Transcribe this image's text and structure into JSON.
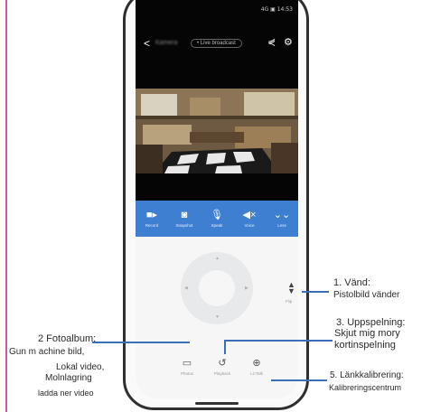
{
  "app": {
    "status_bar": "4G ▣ 14:53",
    "title": "Kamera",
    "live_pill": "• Live broadcast"
  },
  "toolbar": {
    "record": "Record",
    "snapshot": "Snapshot",
    "speak": "Speak",
    "voice": "Voice",
    "less": "Less"
  },
  "controls": {
    "flip_label": "Flip",
    "photos": "Photos",
    "playback": "Playback",
    "cctalk": "LCTalk"
  },
  "annotations": {
    "flip_title": "1. Vänd:",
    "flip_text": "Pistolbild vänder",
    "album_title": "2 Fotoalbum:",
    "album_l1": "Gun m achine bild,",
    "album_l2": "Lokal video,",
    "album_l3": "Molnlagring",
    "album_l4": "ladda ner video",
    "playback_title": "3. Uppspelning:",
    "playback_l1": "Skjut mig mory",
    "playback_l2": "kortinspelning",
    "calib_title": "5. Länkkalibrering:",
    "calib_text": "Kalibreringscentrum"
  },
  "colors": {
    "toolbar_blue": "#3f7fd1",
    "annotation_line": "#3a6fb8",
    "frame_accent": "#c85aa6"
  }
}
